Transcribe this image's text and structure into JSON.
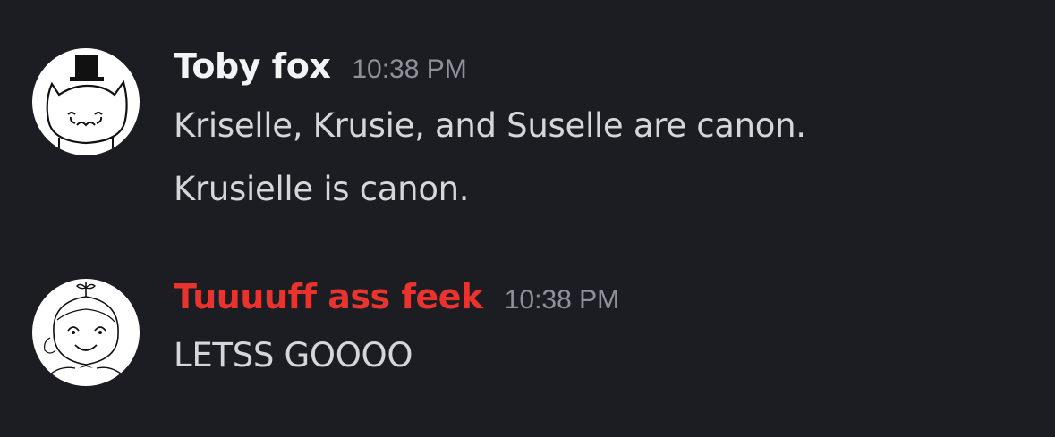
{
  "messages": [
    {
      "author": "Toby fox",
      "timestamp": "10:38 PM",
      "author_color": "#f2f3f5",
      "avatar_icon": "sketched-cat-with-top-hat-icon",
      "lines": [
        "Kriselle, Krusie, and Suselle are canon.",
        "Krusielle is canon."
      ]
    },
    {
      "author": "Tuuuuff ass feek",
      "timestamp": "10:38 PM",
      "author_color": "#e8332e",
      "avatar_icon": "sketched-character-portrait-icon",
      "lines": [
        "LETSS GOOOO"
      ]
    }
  ]
}
